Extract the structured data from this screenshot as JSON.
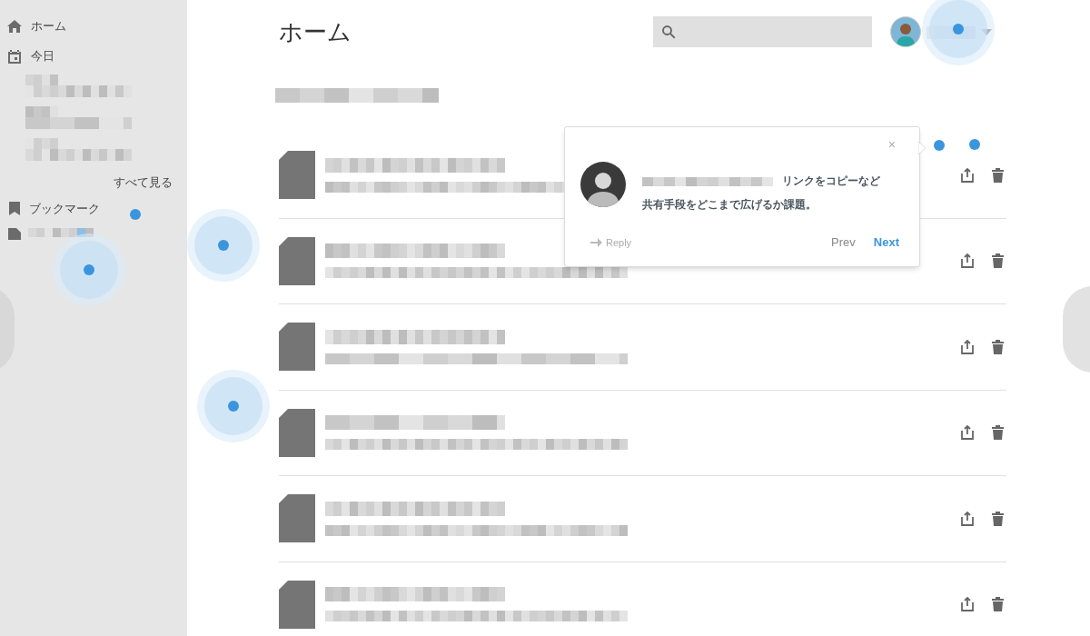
{
  "sidebar": {
    "nav": [
      {
        "kind": "home",
        "label": "ホーム"
      },
      {
        "kind": "today",
        "label": "今日"
      }
    ],
    "today_entries": [
      {
        "kind": "redacted"
      },
      {
        "kind": "redacted"
      },
      {
        "kind": "redacted"
      }
    ],
    "see_all": "すべて見る",
    "bookmarks": {
      "label": "ブックマーク",
      "items": [
        {
          "kind": "redacted"
        }
      ]
    }
  },
  "header": {
    "title": "ホーム"
  },
  "files": [
    {
      "kind": "document"
    },
    {
      "kind": "document"
    },
    {
      "kind": "document"
    },
    {
      "kind": "document"
    },
    {
      "kind": "document"
    },
    {
      "kind": "document"
    }
  ],
  "comment_popover": {
    "close": "×",
    "message": "リンクをコピーなど共有手段をどこまで広げるか課題。",
    "reply": "Reply",
    "prev": "Prev",
    "next": "Next"
  }
}
